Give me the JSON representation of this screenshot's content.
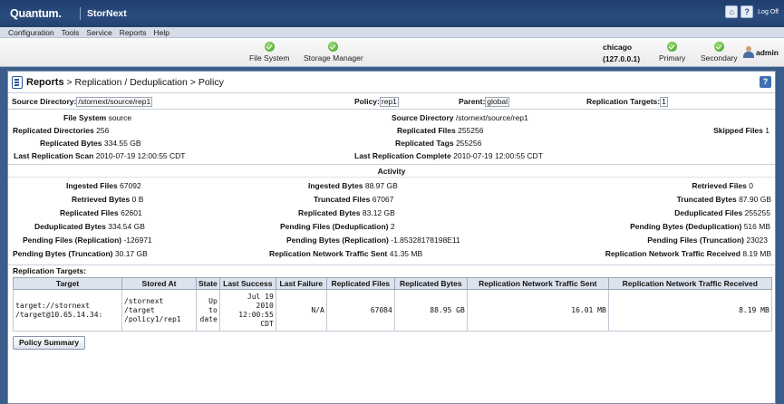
{
  "brand": {
    "company": "Quantum.",
    "product": "StorNext"
  },
  "top_icons": {
    "home": "home-icon",
    "help": "help-icon",
    "logoff_label": "Log Off"
  },
  "menu": [
    "Configuration",
    "Tools",
    "Service",
    "Reports",
    "Help"
  ],
  "status": {
    "items": [
      {
        "label": "File System",
        "icon": "check-circle-icon"
      },
      {
        "label": "Storage Manager",
        "icon": "check-circle-icon"
      }
    ],
    "host_name": "chicago",
    "host_ip": "(127.0.0.1)",
    "primary_label": "Primary",
    "secondary_label": "Secondary",
    "user": "admin"
  },
  "breadcrumb": {
    "root": "Reports",
    "rest": " > Replication / Deduplication > Policy"
  },
  "filters": {
    "source_dir_label": "Source Directory:",
    "source_dir_value": "/stornext/source/rep1",
    "policy_label": "Policy:",
    "policy_value": "rep1",
    "parent_label": "Parent:",
    "parent_value": "global",
    "targets_label": "Replication Targets:",
    "targets_value": "1"
  },
  "info": {
    "file_system": {
      "label": "File System",
      "value": "source"
    },
    "source_directory": {
      "label": "Source Directory",
      "value": "/stornext/source/rep1"
    },
    "replicated_directories": {
      "label": "Replicated Directories",
      "value": "256"
    },
    "replicated_files": {
      "label": "Replicated Files",
      "value": "255256"
    },
    "skipped_files": {
      "label": "Skipped Files",
      "value": "1"
    },
    "replicated_bytes": {
      "label": "Replicated Bytes",
      "value": "334.55 GB"
    },
    "replicated_tags": {
      "label": "Replicated Tags",
      "value": "255256"
    },
    "last_scan": {
      "label": "Last Replication Scan",
      "value": "2010-07-19 12:00:55 CDT"
    },
    "last_complete": {
      "label": "Last Replication Complete",
      "value": "2010-07-19 12:00:55 CDT"
    }
  },
  "activity": {
    "title": "Activity",
    "ingested_files": {
      "label": "Ingested Files",
      "value": "67092"
    },
    "ingested_bytes": {
      "label": "Ingested Bytes",
      "value": "88.97 GB"
    },
    "retrieved_files": {
      "label": "Retrieved Files",
      "value": "0"
    },
    "retrieved_bytes": {
      "label": "Retrieved Bytes",
      "value": "0 B"
    },
    "truncated_files": {
      "label": "Truncated Files",
      "value": "67067"
    },
    "truncated_bytes": {
      "label": "Truncated Bytes",
      "value": "87.90 GB"
    },
    "replicated_files": {
      "label": "Replicated Files",
      "value": "62601"
    },
    "replicated_bytes": {
      "label": "Replicated Bytes",
      "value": "83.12 GB"
    },
    "deduplicated_files": {
      "label": "Deduplicated Files",
      "value": "255255"
    },
    "deduplicated_bytes": {
      "label": "Deduplicated Bytes",
      "value": "334.54 GB"
    },
    "pending_files_dedup": {
      "label": "Pending Files (Deduplication)",
      "value": "2"
    },
    "pending_bytes_dedup": {
      "label": "Pending Bytes (Deduplication)",
      "value": "516 MB"
    },
    "pending_files_repl": {
      "label": "Pending Files (Replication)",
      "value": "-126971"
    },
    "pending_bytes_repl": {
      "label": "Pending Bytes (Replication)",
      "value": "-1.85328178198E11"
    },
    "pending_files_trunc": {
      "label": "Pending Files (Truncation)",
      "value": "23023"
    },
    "pending_bytes_trunc": {
      "label": "Pending Bytes (Truncation)",
      "value": "30.17 GB"
    },
    "traffic_sent": {
      "label": "Replication Network Traffic Sent",
      "value": "41.35 MB"
    },
    "traffic_received": {
      "label": "Replication Network Traffic Received",
      "value": "8.19 MB"
    }
  },
  "targets_section_title": "Replication Targets:",
  "targets_table": {
    "headers": [
      "Target",
      "Stored At",
      "State",
      "Last Success",
      "Last Failure",
      "Replicated Files",
      "Replicated Bytes",
      "Replication Network Traffic Sent",
      "Replication Network Traffic Received"
    ],
    "rows": [
      {
        "target_l1": "target://stornext",
        "target_l2": "/target@10.65.14.34:",
        "stored_l1": "/stornext",
        "stored_l2": "/target",
        "stored_l3": "/policy1/rep1",
        "state_l1": "Up",
        "state_l2": "to",
        "state_l3": "date",
        "success_l1": "Jul 19",
        "success_l2": "2010",
        "success_l3": "12:00:55",
        "success_l4": "CDT",
        "last_failure": "N/A",
        "replicated_files": "67084",
        "replicated_bytes": "88.95 GB",
        "traffic_sent": "16.01 MB",
        "traffic_received": "8.19 MB"
      }
    ]
  },
  "policy_summary_button": "Policy Summary"
}
